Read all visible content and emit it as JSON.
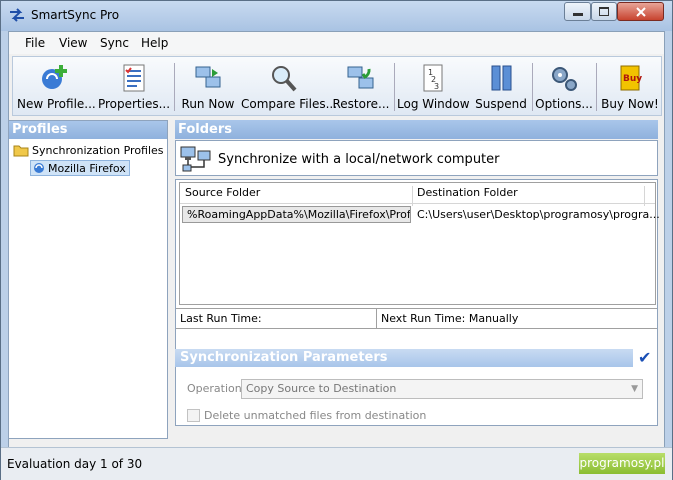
{
  "window": {
    "title": "SmartSync Pro"
  },
  "menu": [
    "File",
    "View",
    "Sync",
    "Help"
  ],
  "toolbar": {
    "new_profile": "New Profile...",
    "properties": "Properties...",
    "run_now": "Run Now",
    "compare_files": "Compare Files...",
    "restore": "Restore...",
    "log_window": "Log Window",
    "suspend": "Suspend",
    "options": "Options...",
    "buy_now": "Buy Now!"
  },
  "profiles": {
    "header": "Profiles",
    "root": "Synchronization Profiles",
    "selected": "Mozilla Firefox"
  },
  "folders": {
    "header": "Folders",
    "sync_type": "Synchronize with a local/network computer",
    "columns": [
      "Source Folder",
      "Destination Folder"
    ],
    "rows": [
      {
        "source": "%RoamingAppData%\\Mozilla\\Firefox\\Prof...",
        "destination": "C:\\Users\\user\\Desktop\\programosy\\progra..."
      }
    ],
    "last_run": "Last Run Time:",
    "next_run": "Next Run Time: Manually"
  },
  "params": {
    "header": "Synchronization Parameters",
    "operation_label": "Operation",
    "operation_value": "Copy Source to Destination",
    "delete_label": "Delete unmatched files from destination"
  },
  "status": {
    "text": "Evaluation day 1 of 30",
    "badge": "programosy.pl"
  },
  "colors": {
    "accent": "#8fb1dd",
    "badge": "#8bbd32",
    "close": "#c7432f"
  }
}
